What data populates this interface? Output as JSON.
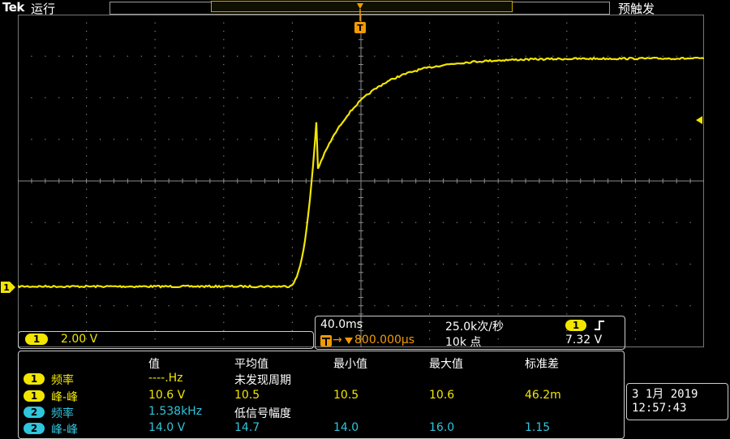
{
  "colors": {
    "ch1": "#f2e600",
    "ch2": "#2fc5dc",
    "trigger": "#f29a00",
    "grid": "#888888"
  },
  "header": {
    "brand": "Tek",
    "run_state": "运行",
    "trigger_state": "预触发"
  },
  "markers": {
    "ch1_label": "1",
    "trigger_label": "T"
  },
  "ch1": {
    "badge": "1",
    "scale": "2.00 V"
  },
  "timebase": {
    "time_per_div": "40.0ms",
    "sample_rate": "25.0k次/秒",
    "trigger_position": "800.000µs",
    "record_length": "10k 点",
    "trigger_channel": "1",
    "trigger_slope_icon": "rising-edge-icon",
    "trigger_level": "7.32 V"
  },
  "measurements": {
    "headers": [
      "值",
      "平均值",
      "最小值",
      "最大值",
      "标准差"
    ],
    "rows": [
      {
        "badge": "1",
        "name": "频率",
        "value": "----.Hz",
        "mean": "未发现周期",
        "min": "",
        "max": "",
        "std": ""
      },
      {
        "badge": "1",
        "name": "峰-峰",
        "value": "10.6 V",
        "mean": "10.5",
        "min": "10.5",
        "max": "10.6",
        "std": "46.2m"
      },
      {
        "badge": "2",
        "name": "频率",
        "value": "1.538kHz",
        "mean": "低信号幅度",
        "min": "",
        "max": "",
        "std": ""
      },
      {
        "badge": "2",
        "name": "峰-峰",
        "value": "14.0 V",
        "mean": "14.7",
        "min": "14.0",
        "max": "16.0",
        "std": "1.15"
      }
    ]
  },
  "datetime": {
    "date": "3 1月  2019",
    "time": "12:57:43"
  }
}
